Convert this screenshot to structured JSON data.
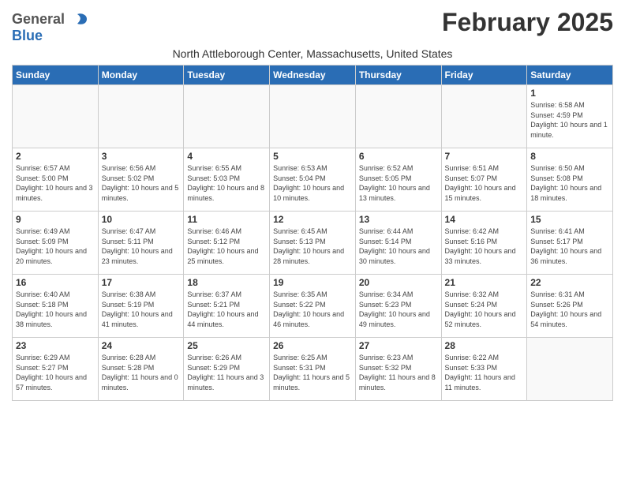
{
  "header": {
    "logo_general": "General",
    "logo_blue": "Blue",
    "month_title": "February 2025",
    "location": "North Attleborough Center, Massachusetts, United States"
  },
  "weekdays": [
    "Sunday",
    "Monday",
    "Tuesday",
    "Wednesday",
    "Thursday",
    "Friday",
    "Saturday"
  ],
  "weeks": [
    [
      {
        "day": "",
        "info": ""
      },
      {
        "day": "",
        "info": ""
      },
      {
        "day": "",
        "info": ""
      },
      {
        "day": "",
        "info": ""
      },
      {
        "day": "",
        "info": ""
      },
      {
        "day": "",
        "info": ""
      },
      {
        "day": "1",
        "info": "Sunrise: 6:58 AM\nSunset: 4:59 PM\nDaylight: 10 hours and 1 minute."
      }
    ],
    [
      {
        "day": "2",
        "info": "Sunrise: 6:57 AM\nSunset: 5:00 PM\nDaylight: 10 hours and 3 minutes."
      },
      {
        "day": "3",
        "info": "Sunrise: 6:56 AM\nSunset: 5:02 PM\nDaylight: 10 hours and 5 minutes."
      },
      {
        "day": "4",
        "info": "Sunrise: 6:55 AM\nSunset: 5:03 PM\nDaylight: 10 hours and 8 minutes."
      },
      {
        "day": "5",
        "info": "Sunrise: 6:53 AM\nSunset: 5:04 PM\nDaylight: 10 hours and 10 minutes."
      },
      {
        "day": "6",
        "info": "Sunrise: 6:52 AM\nSunset: 5:05 PM\nDaylight: 10 hours and 13 minutes."
      },
      {
        "day": "7",
        "info": "Sunrise: 6:51 AM\nSunset: 5:07 PM\nDaylight: 10 hours and 15 minutes."
      },
      {
        "day": "8",
        "info": "Sunrise: 6:50 AM\nSunset: 5:08 PM\nDaylight: 10 hours and 18 minutes."
      }
    ],
    [
      {
        "day": "9",
        "info": "Sunrise: 6:49 AM\nSunset: 5:09 PM\nDaylight: 10 hours and 20 minutes."
      },
      {
        "day": "10",
        "info": "Sunrise: 6:47 AM\nSunset: 5:11 PM\nDaylight: 10 hours and 23 minutes."
      },
      {
        "day": "11",
        "info": "Sunrise: 6:46 AM\nSunset: 5:12 PM\nDaylight: 10 hours and 25 minutes."
      },
      {
        "day": "12",
        "info": "Sunrise: 6:45 AM\nSunset: 5:13 PM\nDaylight: 10 hours and 28 minutes."
      },
      {
        "day": "13",
        "info": "Sunrise: 6:44 AM\nSunset: 5:14 PM\nDaylight: 10 hours and 30 minutes."
      },
      {
        "day": "14",
        "info": "Sunrise: 6:42 AM\nSunset: 5:16 PM\nDaylight: 10 hours and 33 minutes."
      },
      {
        "day": "15",
        "info": "Sunrise: 6:41 AM\nSunset: 5:17 PM\nDaylight: 10 hours and 36 minutes."
      }
    ],
    [
      {
        "day": "16",
        "info": "Sunrise: 6:40 AM\nSunset: 5:18 PM\nDaylight: 10 hours and 38 minutes."
      },
      {
        "day": "17",
        "info": "Sunrise: 6:38 AM\nSunset: 5:19 PM\nDaylight: 10 hours and 41 minutes."
      },
      {
        "day": "18",
        "info": "Sunrise: 6:37 AM\nSunset: 5:21 PM\nDaylight: 10 hours and 44 minutes."
      },
      {
        "day": "19",
        "info": "Sunrise: 6:35 AM\nSunset: 5:22 PM\nDaylight: 10 hours and 46 minutes."
      },
      {
        "day": "20",
        "info": "Sunrise: 6:34 AM\nSunset: 5:23 PM\nDaylight: 10 hours and 49 minutes."
      },
      {
        "day": "21",
        "info": "Sunrise: 6:32 AM\nSunset: 5:24 PM\nDaylight: 10 hours and 52 minutes."
      },
      {
        "day": "22",
        "info": "Sunrise: 6:31 AM\nSunset: 5:26 PM\nDaylight: 10 hours and 54 minutes."
      }
    ],
    [
      {
        "day": "23",
        "info": "Sunrise: 6:29 AM\nSunset: 5:27 PM\nDaylight: 10 hours and 57 minutes."
      },
      {
        "day": "24",
        "info": "Sunrise: 6:28 AM\nSunset: 5:28 PM\nDaylight: 11 hours and 0 minutes."
      },
      {
        "day": "25",
        "info": "Sunrise: 6:26 AM\nSunset: 5:29 PM\nDaylight: 11 hours and 3 minutes."
      },
      {
        "day": "26",
        "info": "Sunrise: 6:25 AM\nSunset: 5:31 PM\nDaylight: 11 hours and 5 minutes."
      },
      {
        "day": "27",
        "info": "Sunrise: 6:23 AM\nSunset: 5:32 PM\nDaylight: 11 hours and 8 minutes."
      },
      {
        "day": "28",
        "info": "Sunrise: 6:22 AM\nSunset: 5:33 PM\nDaylight: 11 hours and 11 minutes."
      },
      {
        "day": "",
        "info": ""
      }
    ]
  ]
}
